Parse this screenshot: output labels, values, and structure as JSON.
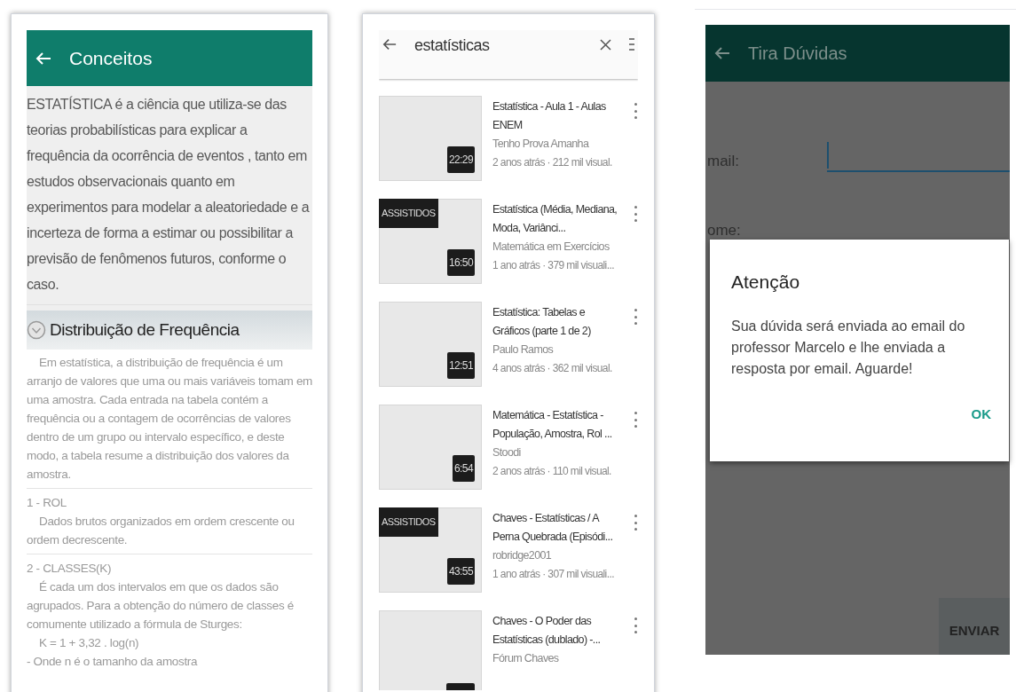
{
  "concepts_screen": {
    "title": "Conceitos",
    "intro": "ESTATÍSTICA é a ciência que utiliza-se das teorias probabilísticas para explicar a frequência da ocorrência de eventos , tanto em estudos observacionais quanto em experimentos para modelar a aleatoriedade e a incerteza de forma a estimar ou possibilitar a previsão de fenômenos futuros, conforme o caso.",
    "section_title": "Distribuição de Frequência",
    "blocks": [
      {
        "kind": "paragraph",
        "text": "Em estatística, a distribuição de frequência é um arranjo de valores que uma ou mais variáveis tomam em uma amostra. Cada entrada na tabela contém a frequência ou a contagem de ocorrências de valores dentro de um grupo ou intervalo específico, e deste modo, a tabela resume a distribuição dos valores da amostra."
      },
      {
        "kind": "divider"
      },
      {
        "kind": "label",
        "text": "1 - ROL"
      },
      {
        "kind": "paragraph",
        "text": "Dados brutos organizados em ordem crescente ou ordem decrescente."
      },
      {
        "kind": "divider"
      },
      {
        "kind": "label",
        "text": "2 - CLASSES(K)"
      },
      {
        "kind": "paragraph",
        "text": "É cada um dos intervalos em que os dados são agrupados. Para a obtenção do número de classes é comumente utilizado a fórmula de Sturges:"
      },
      {
        "kind": "paragraph",
        "text": "K = 1 + 3,32 . log(n)"
      },
      {
        "kind": "label",
        "text": "- Onde n é o tamanho da amostra"
      }
    ]
  },
  "search_screen": {
    "query": "estatísticas",
    "results": [
      {
        "title": "Estatística  -  Aula 1 - Aulas ENEM",
        "channel": "Tenho Prova Amanha",
        "meta": "2 anos atrás · 212 mil visual.",
        "duration": "22:29"
      },
      {
        "title": "Estatística (Média, Mediana, Moda, Variânci...",
        "channel": "Matemática em Exercícios",
        "meta": "1 ano atrás · 379 mil visuali...",
        "duration": "16:50",
        "badge": "ASSISTIDOS"
      },
      {
        "title": "Estatística: Tabelas e Gráficos (parte 1 de 2)",
        "channel": "Paulo Ramos",
        "meta": "4 anos atrás · 362 mil visual.",
        "duration": "12:51"
      },
      {
        "title": "Matemática - Estatística - População, Amostra, Rol ...",
        "channel": "Stoodi",
        "meta": "2 anos atrás · 110 mil visual.",
        "duration": "6:54"
      },
      {
        "title": "Chaves - Estatísticas / A Perna Quebrada (Episódi...",
        "channel": "robridge2001",
        "meta": "1 ano atrás · 307 mil visuali...",
        "duration": "43:55",
        "badge": "ASSISTIDOS"
      },
      {
        "title": "Chaves - O Poder das Estatísticas (dublado) -...",
        "channel": "Fórum Chaves"
      }
    ]
  },
  "questions_screen": {
    "title": "Tira Dúvidas",
    "fields": [
      {
        "label": "mail:",
        "focused": true
      },
      {
        "label": "ome:",
        "focused": false
      }
    ],
    "send_button": "ENVIAR",
    "dialog": {
      "title": "Atenção",
      "message": "Sua dúvida será enviada ao email do professor Marcelo e lhe enviada a resposta por email. Aguarde!",
      "button": "OK"
    }
  }
}
